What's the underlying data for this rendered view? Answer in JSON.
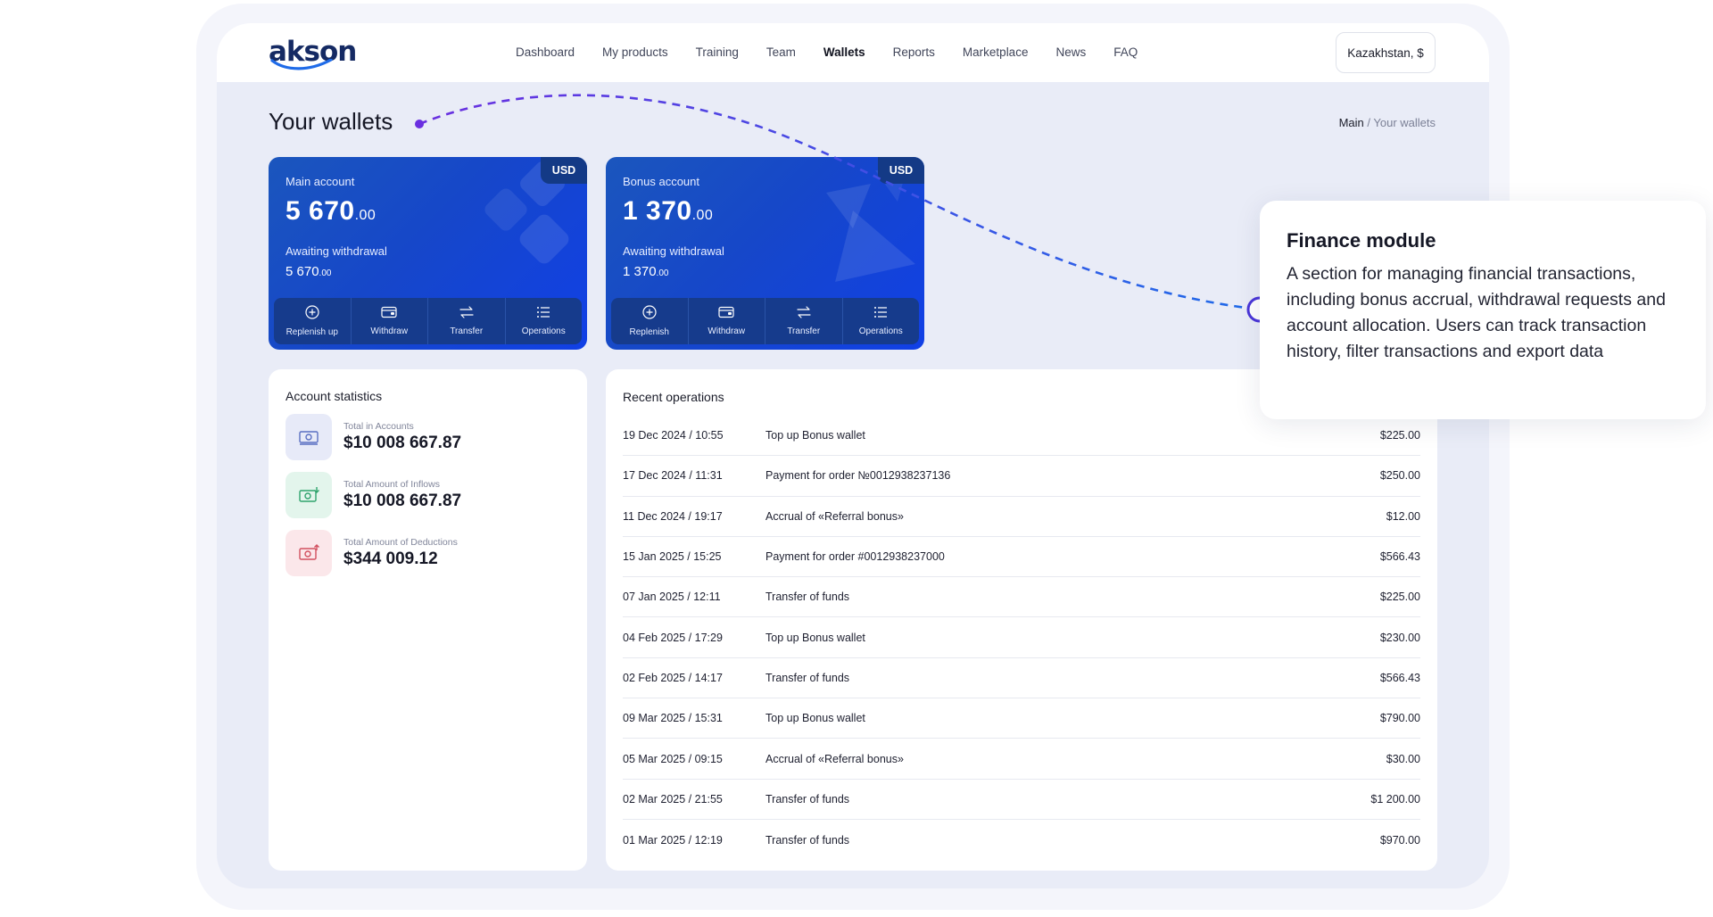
{
  "brand": {
    "logo_text": "akson"
  },
  "nav": {
    "items": [
      {
        "label": "Dashboard"
      },
      {
        "label": "My products"
      },
      {
        "label": "Training"
      },
      {
        "label": "Team"
      },
      {
        "label": "Wallets"
      },
      {
        "label": "Reports"
      },
      {
        "label": "Marketplace"
      },
      {
        "label": "News"
      },
      {
        "label": "FAQ"
      }
    ],
    "active": "Wallets"
  },
  "region": {
    "label": "Kazakhstan, $"
  },
  "page": {
    "title": "Your wallets",
    "breadcrumb": {
      "main": "Main",
      "separator": " / ",
      "current": "Your wallets"
    }
  },
  "wallets": [
    {
      "currency": "USD",
      "account_label": "Main account",
      "balance_int": "5 670",
      "balance_dec": ".00",
      "awaiting_label": "Awaiting withdrawal",
      "awaiting_int": "5 670",
      "awaiting_dec": ".00",
      "actions": [
        {
          "label": "Replenish up",
          "icon": "plus-circle-icon"
        },
        {
          "label": "Withdraw",
          "icon": "wallet-icon"
        },
        {
          "label": "Transfer",
          "icon": "transfer-icon"
        },
        {
          "label": "Operations",
          "icon": "list-icon"
        }
      ]
    },
    {
      "currency": "USD",
      "account_label": "Bonus account",
      "balance_int": "1 370",
      "balance_dec": ".00",
      "awaiting_label": "Awaiting withdrawal",
      "awaiting_int": "1 370",
      "awaiting_dec": ".00",
      "actions": [
        {
          "label": "Replenish",
          "icon": "plus-circle-icon"
        },
        {
          "label": "Withdraw",
          "icon": "wallet-icon"
        },
        {
          "label": "Transfer",
          "icon": "transfer-icon"
        },
        {
          "label": "Operations",
          "icon": "list-icon"
        }
      ]
    }
  ],
  "stats": {
    "title": "Account statistics",
    "items": [
      {
        "label": "Total in Accounts",
        "value": "$10 008 667.87",
        "icon": "cash-icon",
        "color": "#5a6fc2",
        "bg": "#e7eaf8"
      },
      {
        "label": "Total Amount of Inflows",
        "value": "$10 008 667.87",
        "icon": "cash-in-icon",
        "color": "#2fa36d",
        "bg": "#e3f5ec"
      },
      {
        "label": "Total Amount of Deductions",
        "value": "$344 009.12",
        "icon": "cash-out-icon",
        "color": "#d2505f",
        "bg": "#fbe7ea"
      }
    ]
  },
  "operations": {
    "title": "Recent operations",
    "rows": [
      {
        "date": "19 Dec 2024 / 10:55",
        "desc": "Top up Bonus wallet",
        "amount": "$225.00"
      },
      {
        "date": "17 Dec 2024 / 11:31",
        "desc": "Payment for order №0012938237136",
        "amount": "$250.00"
      },
      {
        "date": "11 Dec 2024 / 19:17",
        "desc": "Accrual of «Referral bonus»",
        "amount": "$12.00"
      },
      {
        "date": "15 Jan 2025 / 15:25",
        "desc": "Payment for order #0012938237000",
        "amount": "$566.43"
      },
      {
        "date": "07 Jan 2025 / 12:11",
        "desc": "Transfer of funds",
        "amount": "$225.00"
      },
      {
        "date": "04 Feb 2025 / 17:29",
        "desc": "Top up Bonus wallet",
        "amount": "$230.00"
      },
      {
        "date": "02 Feb 2025 / 14:17",
        "desc": "Transfer of funds",
        "amount": "$566.43"
      },
      {
        "date": "09 Mar 2025 / 15:31",
        "desc": "Top up Bonus wallet",
        "amount": "$790.00"
      },
      {
        "date": "05 Mar 2025 / 09:15",
        "desc": "Accrual of «Referral bonus»",
        "amount": "$30.00"
      },
      {
        "date": "02 Mar 2025 / 21:55",
        "desc": "Transfer of funds",
        "amount": "$1 200.00"
      },
      {
        "date": "01 Mar 2025 / 12:19",
        "desc": "Transfer of funds",
        "amount": "$970.00"
      }
    ]
  },
  "callout": {
    "title": "Finance module",
    "text": "A section for managing financial transactions, including bonus accrual, withdrawal requests and account allocation. Users can track transaction history, filter transactions and export data"
  },
  "colors": {
    "accent_blue": "#1647c9",
    "connector_start": "#6a2fe0",
    "connector_end": "#1f6be8"
  }
}
